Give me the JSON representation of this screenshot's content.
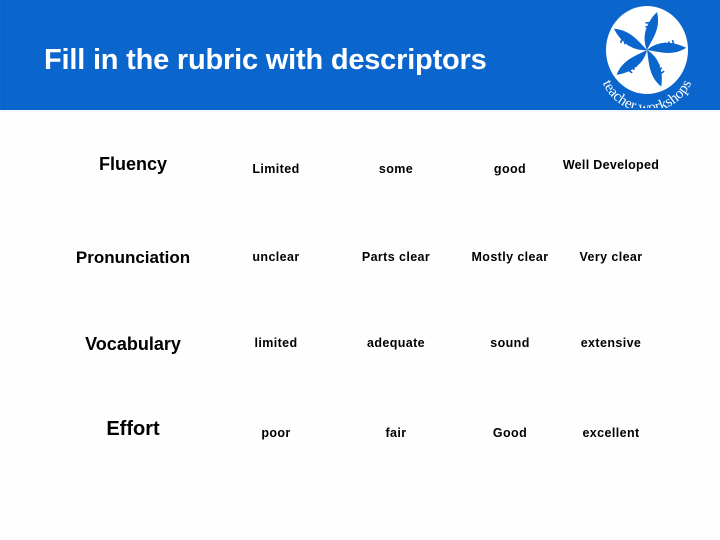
{
  "slide": {
    "title": "Fill in the rubric with descriptors",
    "header_color": "#0a66cc",
    "title_color": "#ffffff",
    "background_color": "#ffffff"
  },
  "logo": {
    "name": "teacher-workshops-logo",
    "text": "teacher workshops",
    "shape": "pinwheel-circle"
  },
  "rubric": {
    "rows": [
      {
        "criterion": "Fluency",
        "levels": [
          "Limited",
          "some",
          "good",
          "Well Developed"
        ],
        "last_level_wraps": true
      },
      {
        "criterion": "Pronunciation",
        "levels": [
          "unclear",
          "Parts clear",
          "Mostly clear",
          "Very clear"
        ],
        "last_level_wraps": false
      },
      {
        "criterion": "Vocabulary",
        "levels": [
          "limited",
          "adequate",
          "sound",
          "extensive"
        ],
        "last_level_wraps": false
      },
      {
        "criterion": "Effort",
        "levels": [
          "poor",
          "fair",
          "Good",
          "excellent"
        ],
        "last_level_wraps": false
      }
    ]
  }
}
